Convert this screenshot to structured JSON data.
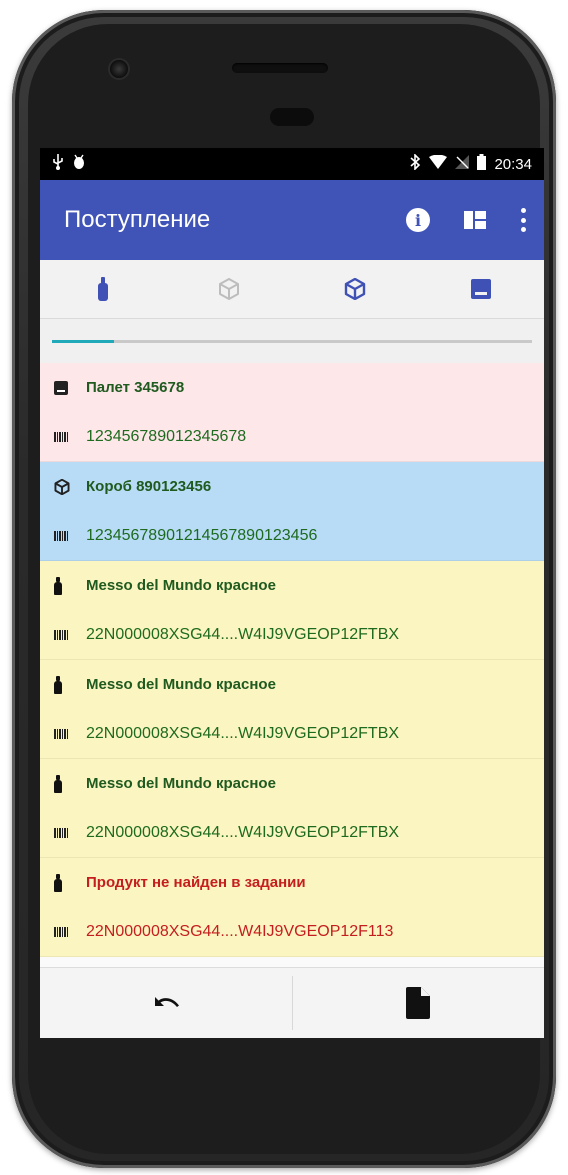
{
  "status_bar": {
    "time": "20:34",
    "left_icons": [
      "usb-icon",
      "android-debug-icon"
    ],
    "right_icons": [
      "bluetooth-icon",
      "wifi-icon",
      "no-sim-icon",
      "battery-icon"
    ]
  },
  "app_bar": {
    "title": "Поступление",
    "actions": [
      "info-icon",
      "view-quilt-icon",
      "more-vert-icon"
    ],
    "color": "#4054b8"
  },
  "tabs": [
    {
      "icon": "bottle-icon",
      "active": true
    },
    {
      "icon": "box-outline-icon",
      "active": false
    },
    {
      "icon": "box-icon",
      "active": false
    },
    {
      "icon": "pallet-icon",
      "active": false
    }
  ],
  "progress": {
    "fraction": 0.13,
    "color": "#1fa9b9"
  },
  "items": [
    {
      "type": "pallet",
      "bg": "#fde7e9",
      "title": "Палет 345678",
      "code": "123456789012345678",
      "error": false
    },
    {
      "type": "box",
      "bg": "#b8dcf6",
      "title": "Короб 890123456",
      "code": "12345678901214567890123456",
      "error": false
    },
    {
      "type": "bottle",
      "bg": "#fbf5c1",
      "title": "Messo del Mundo красное",
      "code": "22N000008XSG44....W4IJ9VGEOP12FTBX",
      "error": false
    },
    {
      "type": "bottle",
      "bg": "#fbf5c1",
      "title": "Messo del Mundo красное",
      "code": "22N000008XSG44....W4IJ9VGEOP12FTBX",
      "error": false
    },
    {
      "type": "bottle",
      "bg": "#fbf5c1",
      "title": "Messo del Mundo красное",
      "code": "22N000008XSG44....W4IJ9VGEOP12FTBX",
      "error": false
    },
    {
      "type": "bottle",
      "bg": "#fbf5c1",
      "title": "Продукт не найден в задании",
      "code": "22N000008XSG44....W4IJ9VGEOP12F113",
      "error": true
    }
  ],
  "bottom_bar": {
    "buttons": [
      "undo-icon",
      "document-icon"
    ]
  }
}
